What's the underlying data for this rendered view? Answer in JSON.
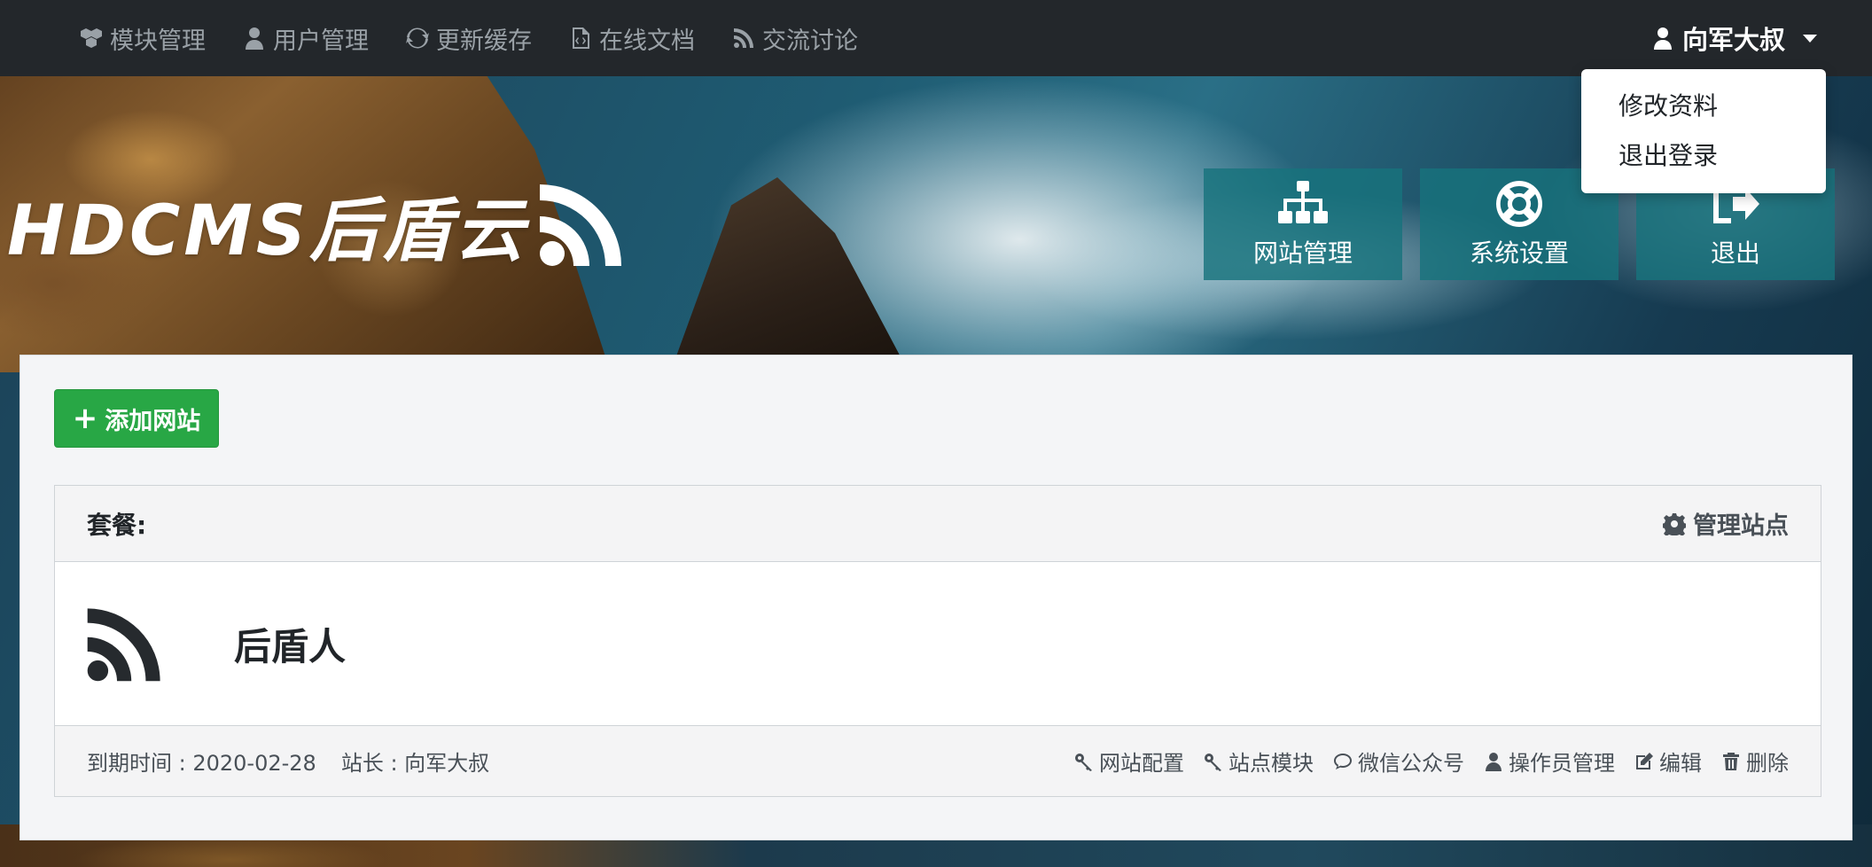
{
  "navbar": {
    "items": [
      {
        "label": "模块管理",
        "icon": "cubes-icon"
      },
      {
        "label": "用户管理",
        "icon": "user-icon"
      },
      {
        "label": "更新缓存",
        "icon": "refresh-icon"
      },
      {
        "label": "在线文档",
        "icon": "file-code-icon"
      },
      {
        "label": "交流讨论",
        "icon": "rss-icon"
      }
    ],
    "user_name": "向军大叔"
  },
  "user_menu": {
    "items": [
      "修改资料",
      "退出登录"
    ]
  },
  "logo": {
    "text": "HDCMS后盾云"
  },
  "tiles": [
    {
      "label": "网站管理",
      "icon": "sitemap-icon"
    },
    {
      "label": "系统设置",
      "icon": "life-ring-icon"
    },
    {
      "label": "退出",
      "icon": "sign-out-icon"
    }
  ],
  "main": {
    "add_site_label": "添加网站",
    "card": {
      "package_label": "套餐:",
      "manage_label": "管理站点",
      "site_name": "后盾人",
      "expire": "到期时间 : 2020-02-28",
      "owner": "站长 : 向军大叔",
      "actions": [
        {
          "label": "网站配置",
          "icon": "key-icon"
        },
        {
          "label": "站点模块",
          "icon": "key-icon"
        },
        {
          "label": "微信公众号",
          "icon": "comment-icon"
        },
        {
          "label": "操作员管理",
          "icon": "user-icon"
        },
        {
          "label": "编辑",
          "icon": "edit-icon"
        },
        {
          "label": "删除",
          "icon": "trash-icon"
        }
      ]
    }
  }
}
